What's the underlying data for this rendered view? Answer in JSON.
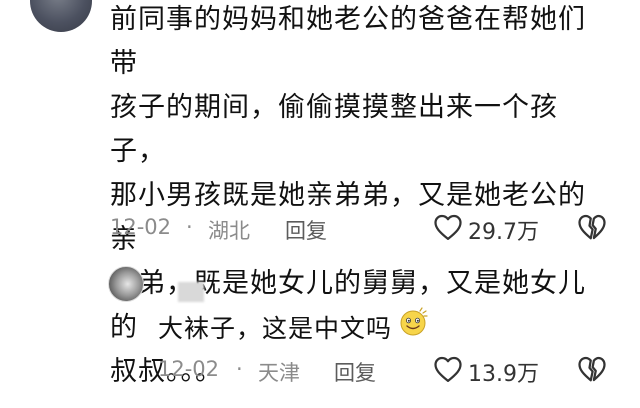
{
  "main_comment": {
    "text": "前同事的妈妈和她老公的爸爸在帮她们带\n孩子的期间，偷偷摸摸整出来一个孩子，\n那小男孩既是她亲弟弟，又是她老公的亲\n弟弟，既是她女儿的舅舅，又是她女儿的\n叔叔。。。",
    "date": "12-02",
    "separator": "·",
    "location": "湖北",
    "reply_label": "回复",
    "like_count": "29.7万"
  },
  "reply_comment": {
    "text": "大袜子，这是中文吗",
    "emoji": "smile-emoji",
    "date": "12-02",
    "separator": "·",
    "location": "天津",
    "reply_label": "回复",
    "like_count": "13.9万"
  },
  "colors": {
    "meta": "#8b8b8b",
    "text": "#111111",
    "icon": "#333333"
  }
}
